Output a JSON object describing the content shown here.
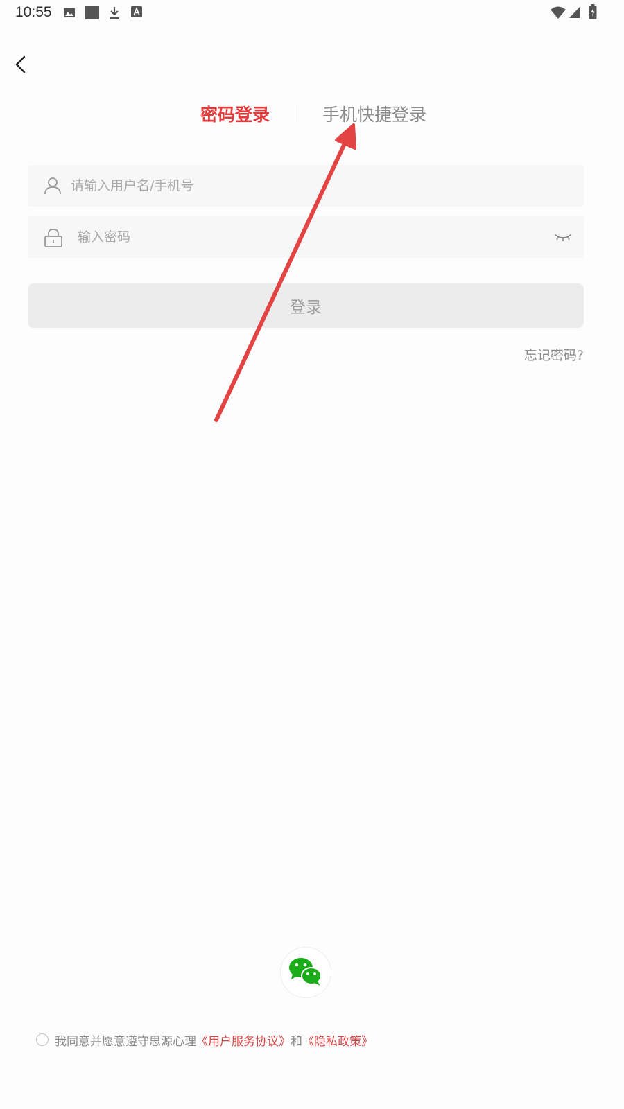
{
  "status_bar": {
    "time": "10:55",
    "icons": [
      "image-icon",
      "square-icon",
      "download-icon",
      "a-badge-icon",
      "wifi-icon",
      "signal-icon",
      "battery-icon"
    ]
  },
  "nav": {
    "back_icon": "chevron-left-icon"
  },
  "tabs": {
    "password_login": "密码登录",
    "phone_login": "手机快捷登录",
    "active": "password_login",
    "active_color": "#e33a3c"
  },
  "form": {
    "username_placeholder": "请输入用户名/手机号",
    "username_value": "",
    "password_placeholder": "输入密码",
    "password_value": "",
    "login_button": "登录",
    "forgot_password": "忘记密码?"
  },
  "third_party": {
    "wechat_icon": "wechat-icon",
    "wechat_color": "#1aad19"
  },
  "agreement": {
    "prefix": "我同意并愿意遵守思源心理",
    "user_agreement": "《用户服务协议》",
    "and": "和",
    "privacy_policy": "《隐私政策》",
    "checked": false,
    "link_color": "#d54545"
  },
  "annotation": {
    "arrow_color": "#e24444",
    "points_to": "tab-phone-login"
  }
}
